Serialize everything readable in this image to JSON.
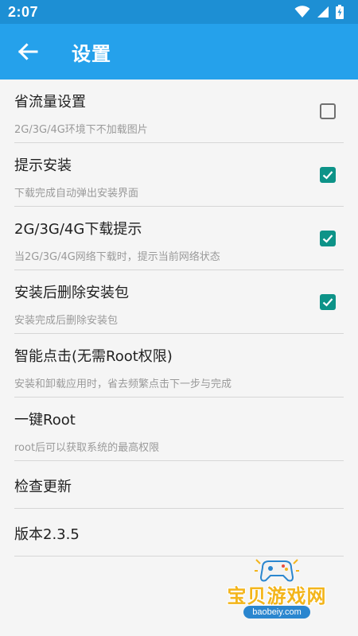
{
  "status_bar": {
    "time": "2:07",
    "icons": [
      "wifi-icon",
      "signal-icon",
      "battery-icon"
    ],
    "color": "#1d8fd4"
  },
  "header": {
    "title": "设置",
    "back_icon": "arrow-left-icon",
    "color": "#25a1eb"
  },
  "settings": [
    {
      "title": "省流量设置",
      "subtitle": "2G/3G/4G环境下不加载图片",
      "checked": false
    },
    {
      "title": "提示安装",
      "subtitle": "下载完成自动弹出安装界面",
      "checked": true
    },
    {
      "title": "2G/3G/4G下载提示",
      "subtitle": "当2G/3G/4G网络下载时，提示当前网络状态",
      "checked": true
    },
    {
      "title": "安装后删除安装包",
      "subtitle": "安装完成后删除安装包",
      "checked": true
    },
    {
      "title": "智能点击(无需Root权限)",
      "subtitle": "安装和卸载应用时，省去频繁点击下一步与完成"
    },
    {
      "title": "一键Root",
      "subtitle": "root后可以获取系统的最高权限"
    },
    {
      "title": "检查更新"
    },
    {
      "title": "版本2.3.5"
    }
  ],
  "checkbox_color": "#0d9388",
  "watermark": {
    "name": "宝贝游戏网",
    "url": "baobeiy.com",
    "icon": "gamepad-icon"
  }
}
